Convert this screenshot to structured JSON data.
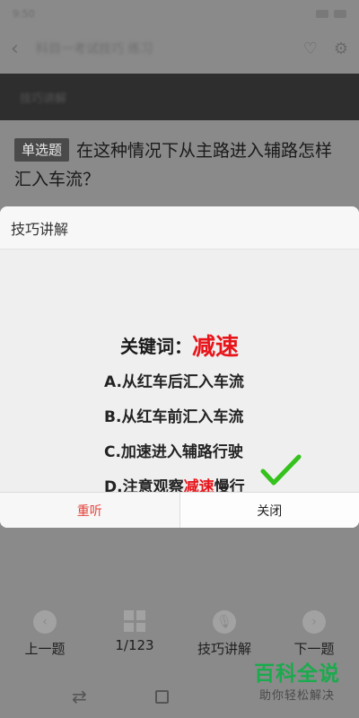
{
  "background": {
    "status_time": "9:50",
    "header_title": "科目一考试技巧 练习",
    "dark_band_text": "技巧讲解",
    "question_badge": "单选题",
    "question_text": "在这种情况下从主路进入辅路怎样汇入车流？"
  },
  "bottom_nav": {
    "prev": "上一题",
    "counter": "1/123",
    "explain": "技巧讲解",
    "next": "下一题"
  },
  "modal": {
    "title": "技巧讲解",
    "keyword_label": "关键词：",
    "keyword_value": "减速",
    "options": {
      "a": "A.从红车后汇入车流",
      "b": "B.从红车前汇入车流",
      "c": "C.加速进入辅路行驶",
      "d_prefix": "D.注意观察",
      "d_highlight": "减速",
      "d_suffix": "慢行"
    },
    "replay_label": "重听",
    "close_label": "关闭"
  },
  "watermark": {
    "main": "百科全说",
    "sub": "助你轻松解决"
  },
  "icons": {
    "check": "check-icon",
    "back": "back-arrow-icon"
  },
  "colors": {
    "accent_red": "#e8141a",
    "check_green": "#35c21c",
    "watermark_green": "#1aab4c"
  }
}
